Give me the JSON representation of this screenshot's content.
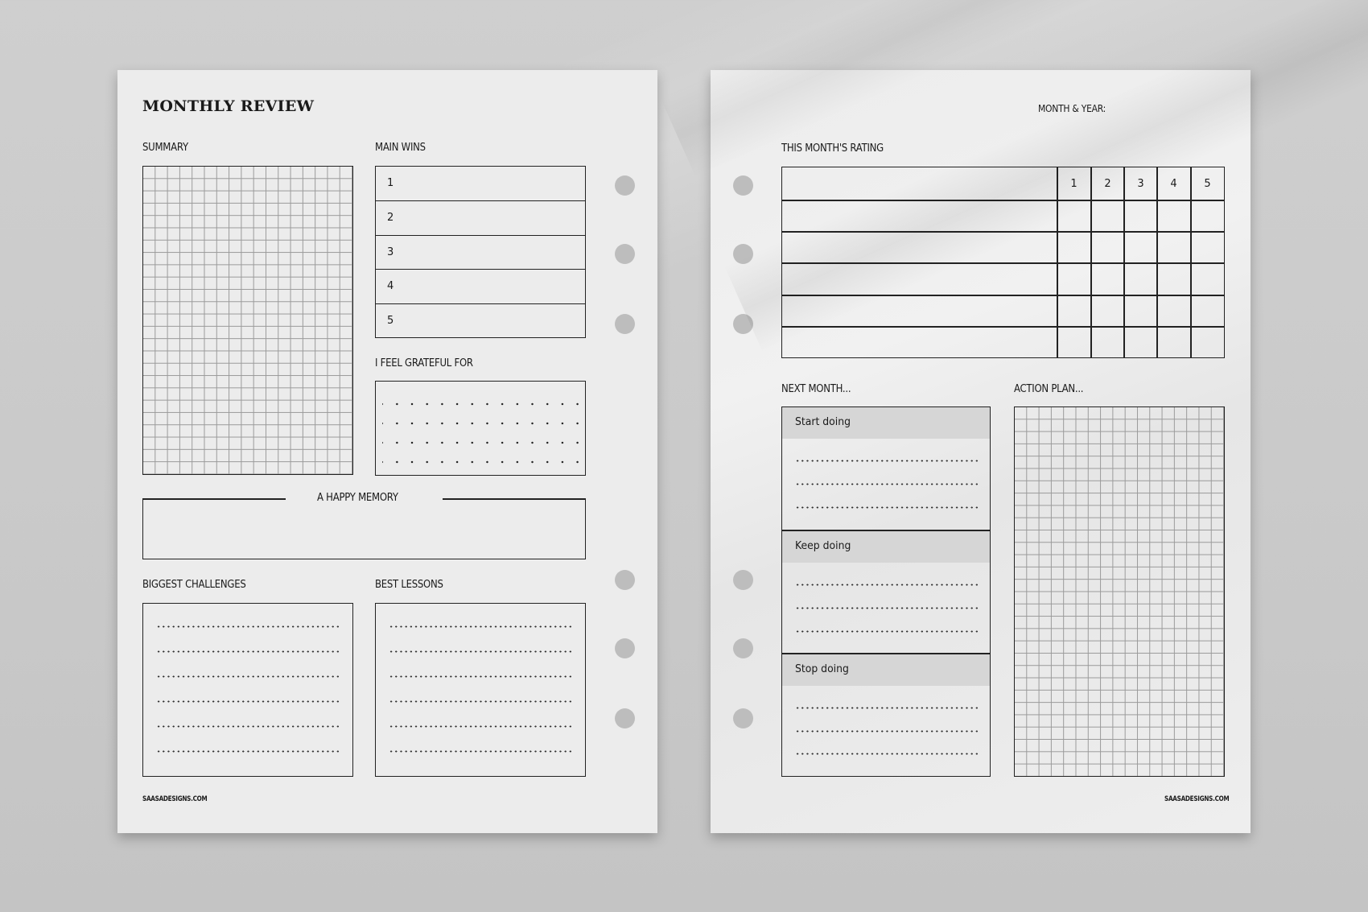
{
  "left_page": {
    "title": "MONTHLY REVIEW",
    "summary_label": "SUMMARY",
    "main_wins_label": "MAIN WINS",
    "main_wins": [
      "1",
      "2",
      "3",
      "4",
      "5"
    ],
    "grateful_label": "I FEEL GRATEFUL FOR",
    "happy_memory_label": "A HAPPY MEMORY",
    "challenges_label": "BIGGEST CHALLENGES",
    "lessons_label": "BEST LESSONS",
    "footer": "SAASADESIGNS.COM"
  },
  "right_page": {
    "month_year_label": "MONTH & YEAR:",
    "rating_label": "THIS MONTH'S RATING",
    "rating_scale": [
      "1",
      "2",
      "3",
      "4",
      "5"
    ],
    "next_month_label": "NEXT MONTH...",
    "next_month_sections": [
      "Start doing",
      "Keep doing",
      "Stop doing"
    ],
    "action_plan_label": "ACTION PLAN...",
    "footer": "SAASADESIGNS.COM"
  },
  "colors": {
    "paper": "#ececec",
    "background": "#c9c9c9",
    "ink": "#1a1a1a",
    "grid_line": "#9a9a9a",
    "hole": "#bdbdbd",
    "section_header": "#d6d6d6"
  }
}
